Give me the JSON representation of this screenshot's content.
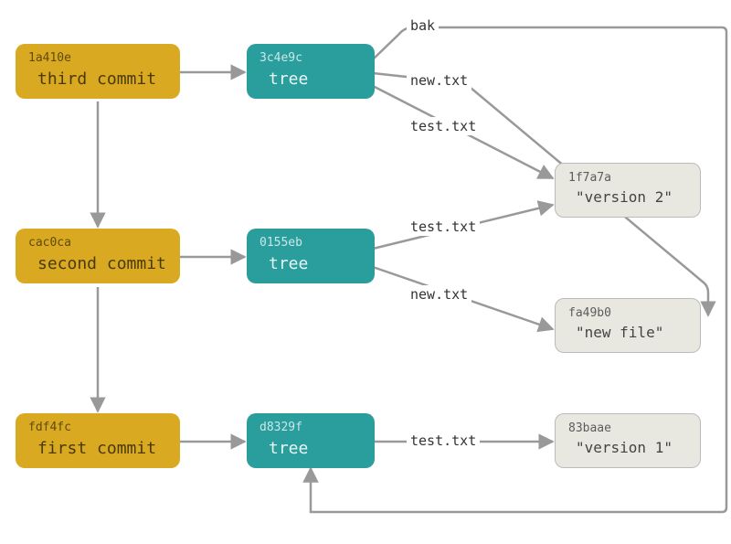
{
  "commits": [
    {
      "hash": "1a410e",
      "label": "third commit"
    },
    {
      "hash": "cac0ca",
      "label": "second commit"
    },
    {
      "hash": "fdf4fc",
      "label": "first commit"
    }
  ],
  "trees": [
    {
      "hash": "3c4e9c",
      "label": "tree"
    },
    {
      "hash": "0155eb",
      "label": "tree"
    },
    {
      "hash": "d8329f",
      "label": "tree"
    }
  ],
  "blobs": [
    {
      "hash": "1f7a7a",
      "label": "\"version 2\""
    },
    {
      "hash": "fa49b0",
      "label": "\"new file\""
    },
    {
      "hash": "83baae",
      "label": "\"version 1\""
    }
  ],
  "edge_labels": {
    "bak": "bak",
    "new_txt": "new.txt",
    "test_txt": "test.txt"
  }
}
